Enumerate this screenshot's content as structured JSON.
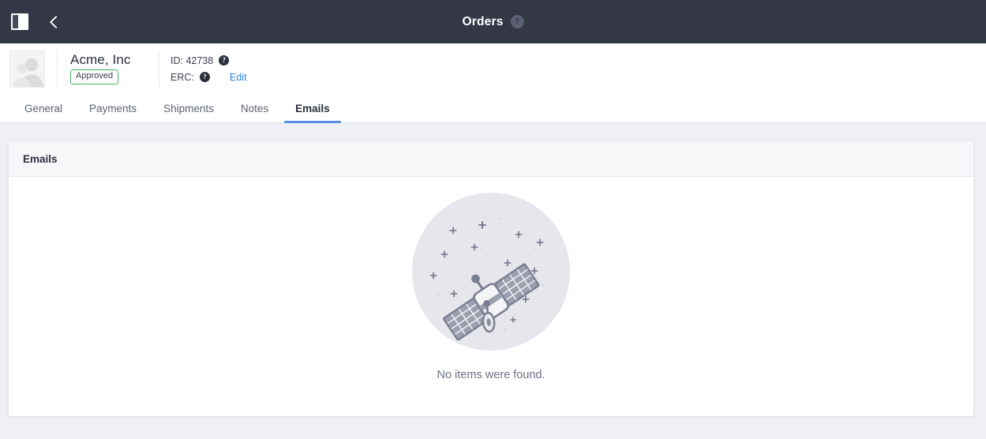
{
  "topbar": {
    "sidebar_toggle_icon": "sidebar-panel-icon",
    "back_icon": "chevron-left-icon",
    "title": "Orders",
    "help_icon": "help-circle-icon",
    "help_glyph": "?",
    "background_color": "#333746"
  },
  "entity": {
    "avatar_icon": "users-placeholder-avatar",
    "name": "Acme, Inc",
    "status": "Approved",
    "status_color": "#42b663",
    "meta": {
      "id_label": "ID: 42738",
      "id_help_glyph": "?",
      "erc_label": "ERC:",
      "erc_help_glyph": "?"
    },
    "edit_label": "Edit",
    "edit_color": "#2f7fe0"
  },
  "tabs": [
    {
      "label": "General",
      "active": false
    },
    {
      "label": "Payments",
      "active": false
    },
    {
      "label": "Shipments",
      "active": false
    },
    {
      "label": "Notes",
      "active": false
    },
    {
      "label": "Emails",
      "active": true
    }
  ],
  "active_tab_accent": "#5b8ee0",
  "card": {
    "header_title": "Emails",
    "empty_state": {
      "illustration_icon": "satellite-in-space-illustration",
      "message": "No items were found.",
      "circle_color": "#e6e7ec",
      "satellite_color": "#7b7f92"
    }
  },
  "page_background": "#eef0f5"
}
